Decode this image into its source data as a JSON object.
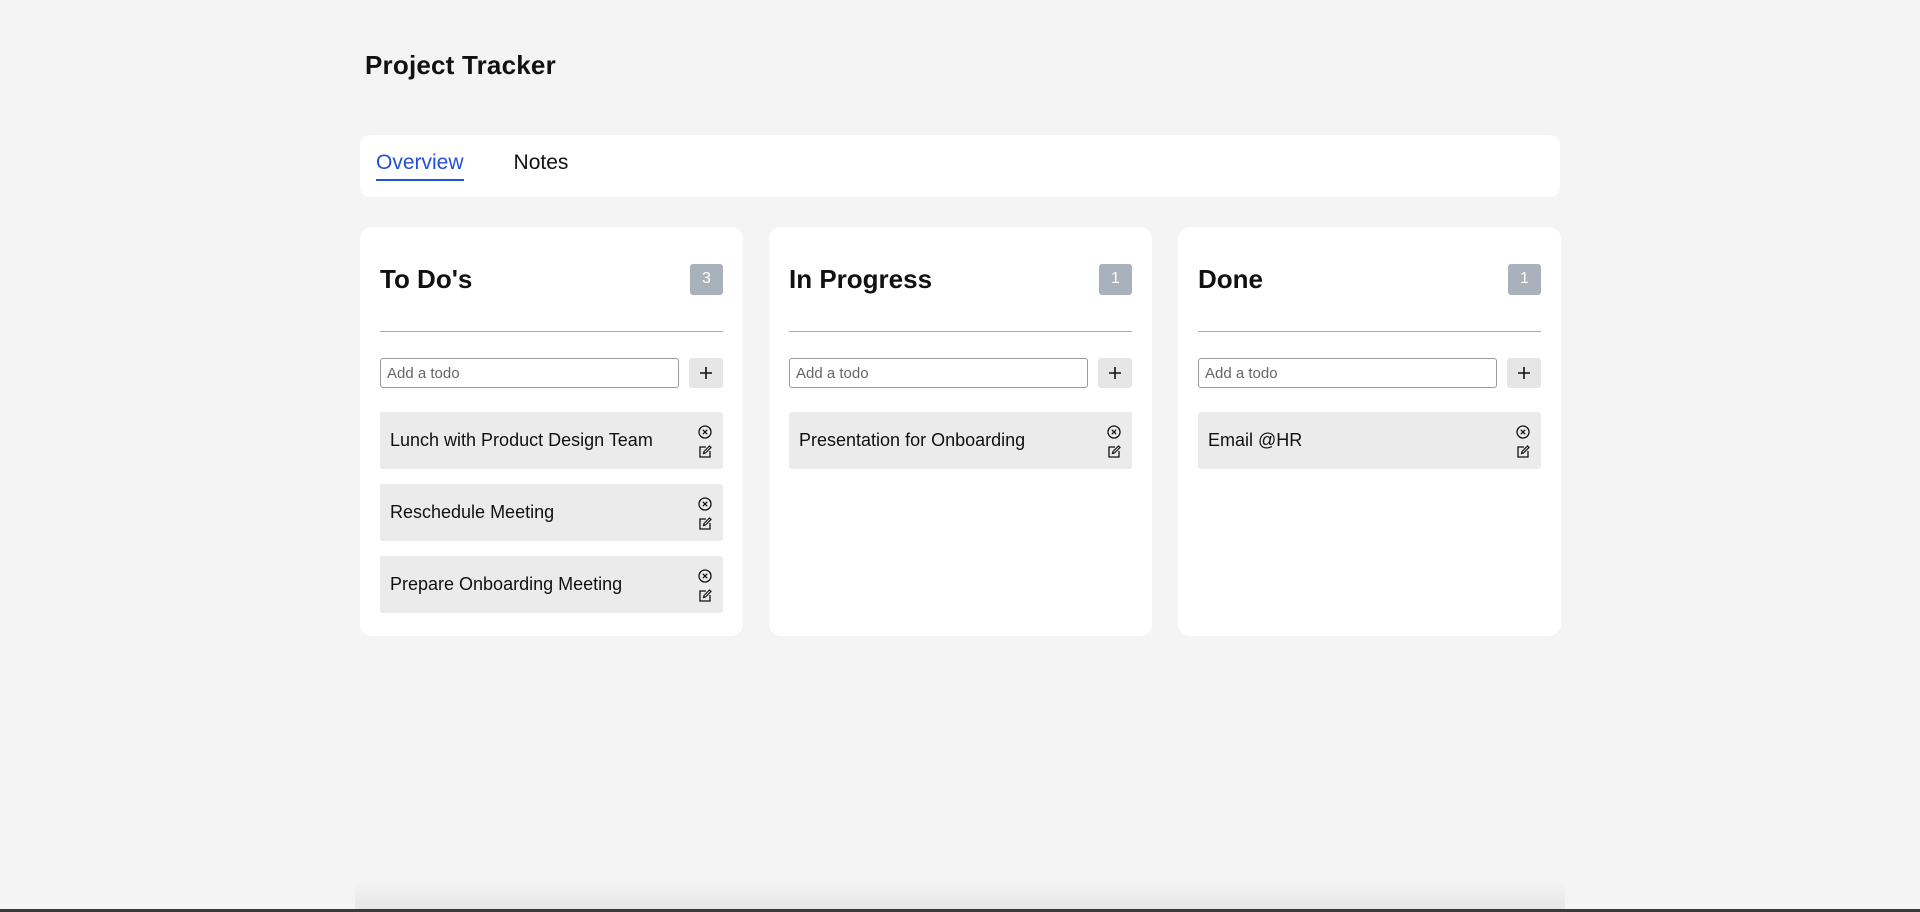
{
  "app": {
    "title": "Project Tracker"
  },
  "tabs": [
    {
      "label": "Overview",
      "active": true
    },
    {
      "label": "Notes",
      "active": false
    }
  ],
  "columns": [
    {
      "title": "To Do's",
      "count": "3",
      "add_placeholder": "Add a todo",
      "items": [
        {
          "text": "Lunch with Product Design Team"
        },
        {
          "text": "Reschedule Meeting"
        },
        {
          "text": "Prepare Onboarding Meeting"
        }
      ]
    },
    {
      "title": "In Progress",
      "count": "1",
      "add_placeholder": "Add a todo",
      "items": [
        {
          "text": "Presentation for Onboarding"
        }
      ]
    },
    {
      "title": "Done",
      "count": "1",
      "add_placeholder": "Add a todo",
      "items": [
        {
          "text": "Email @HR"
        }
      ]
    }
  ],
  "icons": {
    "add": "plus-icon",
    "delete": "close-circle-icon",
    "edit": "edit-icon"
  },
  "colors": {
    "accent": "#2350d8",
    "badge": "#a9b1bd",
    "page_bg": "#f4f4f4",
    "card_bg": "#ffffff",
    "item_bg": "#ebebeb"
  }
}
